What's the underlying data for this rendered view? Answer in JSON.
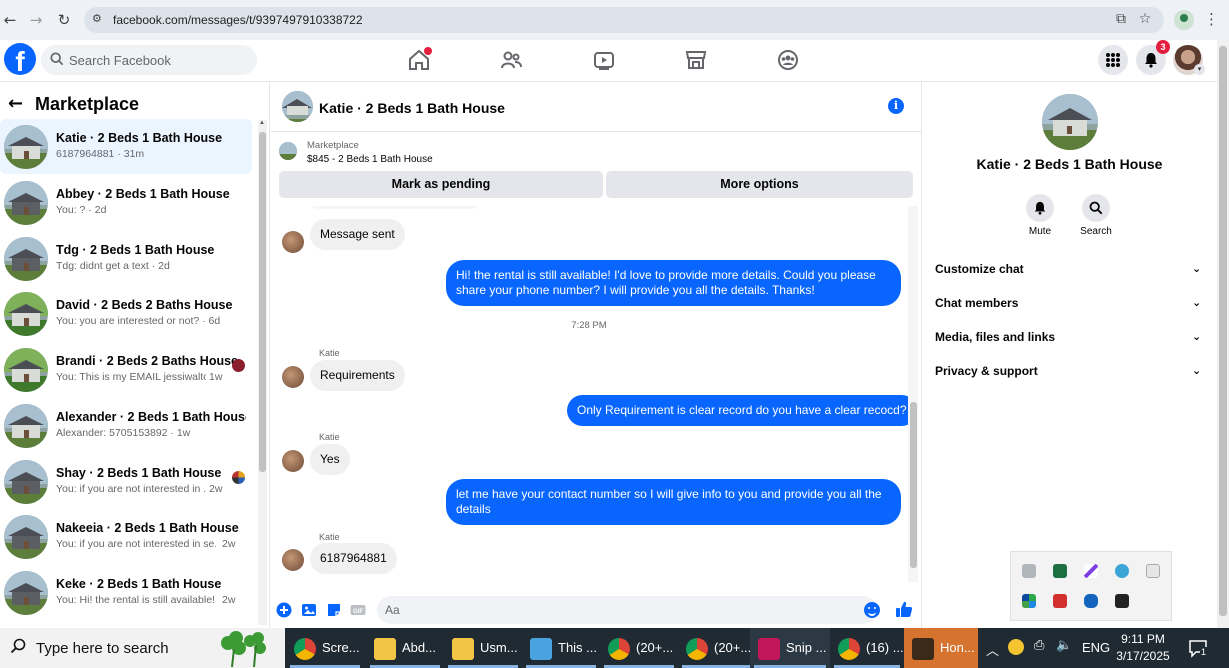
{
  "browser": {
    "url": "facebook.com/messages/t/9397497910338722",
    "back_icon": "arrow-left-icon",
    "forward_icon": "arrow-right-icon",
    "reload_icon": "reload-icon"
  },
  "fb": {
    "search_placeholder": "Search Facebook",
    "notification_count": "3",
    "brand_color": "#0866ff"
  },
  "left": {
    "title": "Marketplace",
    "conversations": [
      {
        "name": "Katie · 2 Beds 1 Bath House",
        "preview": "6187964881 · 31m",
        "age": ""
      },
      {
        "name": "Abbey · 2 Beds 1 Bath House",
        "preview": "You: ? · 2d",
        "age": ""
      },
      {
        "name": "Tdg · 2 Beds 1 Bath House",
        "preview": "Tdg: didnt get a text · 2d",
        "age": ""
      },
      {
        "name": "David · 2 Beds 2 Baths House",
        "preview": "You: you are interested or not? · 6d",
        "age": ""
      },
      {
        "name": "Brandi · 2 Beds 2 Baths House",
        "preview": "You: This is my EMAIL jessiwalto...",
        "age": "1w"
      },
      {
        "name": "Alexander · 2 Beds 1 Bath House",
        "preview": "Alexander: 5705153892 · 1w",
        "age": ""
      },
      {
        "name": "Shay · 2 Beds 1 Bath House",
        "preview": "You: if you are not interested in ...",
        "age": "2w"
      },
      {
        "name": "Nakeeia · 2 Beds 1 Bath House",
        "preview": "You: if you are not interested in se...",
        "age": "2w"
      },
      {
        "name": "Keke · 2 Beds 1 Bath House",
        "preview": "You: Hi! the rental is still available! ...",
        "age": "2w"
      }
    ]
  },
  "chat": {
    "title": "Katie · 2 Beds 1 Bath House",
    "marketplace_label": "Marketplace",
    "listing": "$845 - 2 Beds 1 Bath House",
    "mark_pending": "Mark as pending",
    "more_options": "More options",
    "messages": {
      "m1": "Message sent",
      "m2": "Hi! the rental is still available! I'd love to provide more details. Could you please share your phone number? I will provide you all the details. Thanks!",
      "time": "7:28 PM",
      "sender": "Katie",
      "m3": "Requirements",
      "m4": "Only Requirement is clear record do you  have a clear recocd?",
      "m5": "Yes",
      "m6": "let me have your contact number so I will give info to you and provide you all the details",
      "m7": "6187964881"
    },
    "composer_placeholder": "Aa"
  },
  "right": {
    "name": "Katie · 2 Beds 1 Bath House",
    "mute": "Mute",
    "search": "Search",
    "sections": [
      "Customize chat",
      "Chat members",
      "Media, files and links",
      "Privacy & support"
    ]
  },
  "taskbar": {
    "search_placeholder": "Type here to search",
    "items": [
      "Scre...",
      "Abd...",
      "Usm...",
      "This ...",
      "(20+...",
      "(20+...",
      "Snip ...",
      "(16) ...",
      "Hon..."
    ],
    "lang": "ENG",
    "time": "9:11 PM",
    "date": "3/17/2025",
    "notif_count": "1"
  }
}
